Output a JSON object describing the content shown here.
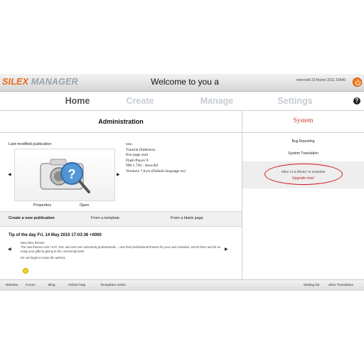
{
  "titlebar": {
    "logo_part1": "SILEX",
    "logo_part2": "MANAGER",
    "welcome": "Welcome to you a",
    "date": "mercredi 23 février 2011 15h40"
  },
  "nav": {
    "tabs": [
      {
        "label": "Home"
      },
      {
        "label": "Create"
      },
      {
        "label": "Manage"
      },
      {
        "label": "Settings"
      }
    ],
    "help": "?"
  },
  "admin": {
    "title": "Administration",
    "last_modified": "Last modified publication",
    "properties": "Properties",
    "open": "Open",
    "publication": {
      "lines": [
        "toto",
        "Tutorial.Slideshow",
        "first page start",
        "Flash Player 8",
        "900 x 720  - showAll",
        "Versions *,fr,en (Default language en)"
      ]
    },
    "create_new": "Create a new publication",
    "from_template": "From a template",
    "from_blank": "From a blank page",
    "tip_title": "Tip of the day Fri, 14 May 2010 17:03:36 +0000",
    "tip_lines": [
      "New Silex themes",
      "The new themes rock ! KAT, SOL and LEO are community professionals ... Use their professional themes for your next creations, enrich them and let us enjoy your gifts by giving to the community back.",
      "Do not forget to name the authors"
    ]
  },
  "system": {
    "title": "System",
    "bug_reporting": "Bug Reporting",
    "translation": "System Translation",
    "available": "Silex v1.6.0beta7 is available",
    "upgrade": "Upgrade now!"
  },
  "footer": {
    "links": [
      "Website",
      "Forum",
      "Blog",
      "Online help",
      "Templates online",
      "Mailing list",
      "Silex Translation"
    ]
  },
  "colors": {
    "accent": "#e86a16",
    "system_title": "#c0392b",
    "highlight": "#d41616"
  }
}
